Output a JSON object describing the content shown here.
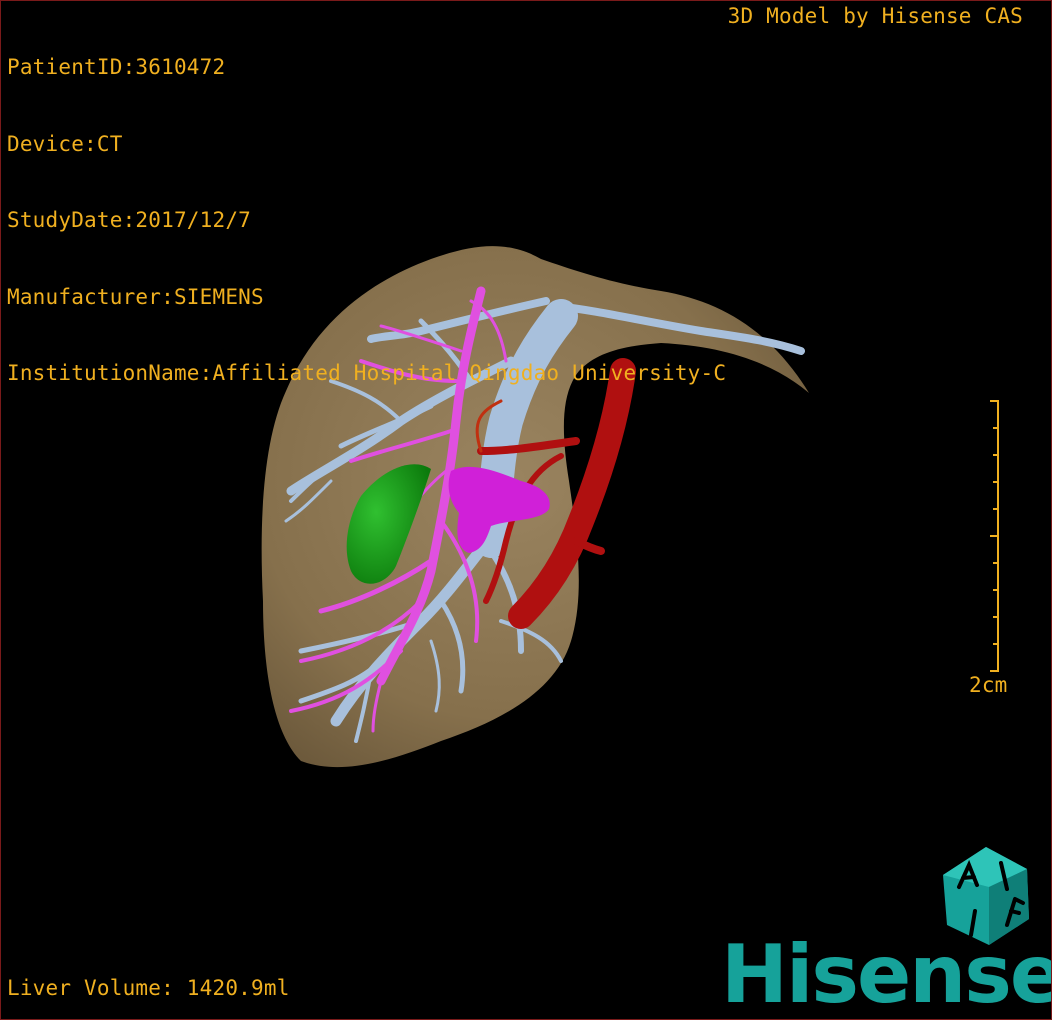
{
  "header": {
    "patient_id": "PatientID:3610472",
    "device": "Device:CT",
    "study_date": "StudyDate:2017/12/7",
    "manufacturer": "Manufacturer:SIEMENS",
    "institution": "InstitutionName:Affiliated Hospital Qingdao University-C"
  },
  "credit": "3D Model by Hisense CAS",
  "scale": {
    "label": "2cm"
  },
  "footer": {
    "liver_volume": "Liver Volume: 1420.9ml"
  },
  "brand": {
    "wordmark": "Hisense",
    "emblem_text": "AIF"
  },
  "colors": {
    "overlay_text": "#f0b020",
    "liver": "#8a7350",
    "portal_vein": "#a8c0dc",
    "hepatic_vein": "#e050e0",
    "artery": "#b01010",
    "tumor": "#18a018",
    "brand": "#16a29a"
  },
  "icons": {
    "brand_emblem": "hexagon-emblem-icon"
  }
}
